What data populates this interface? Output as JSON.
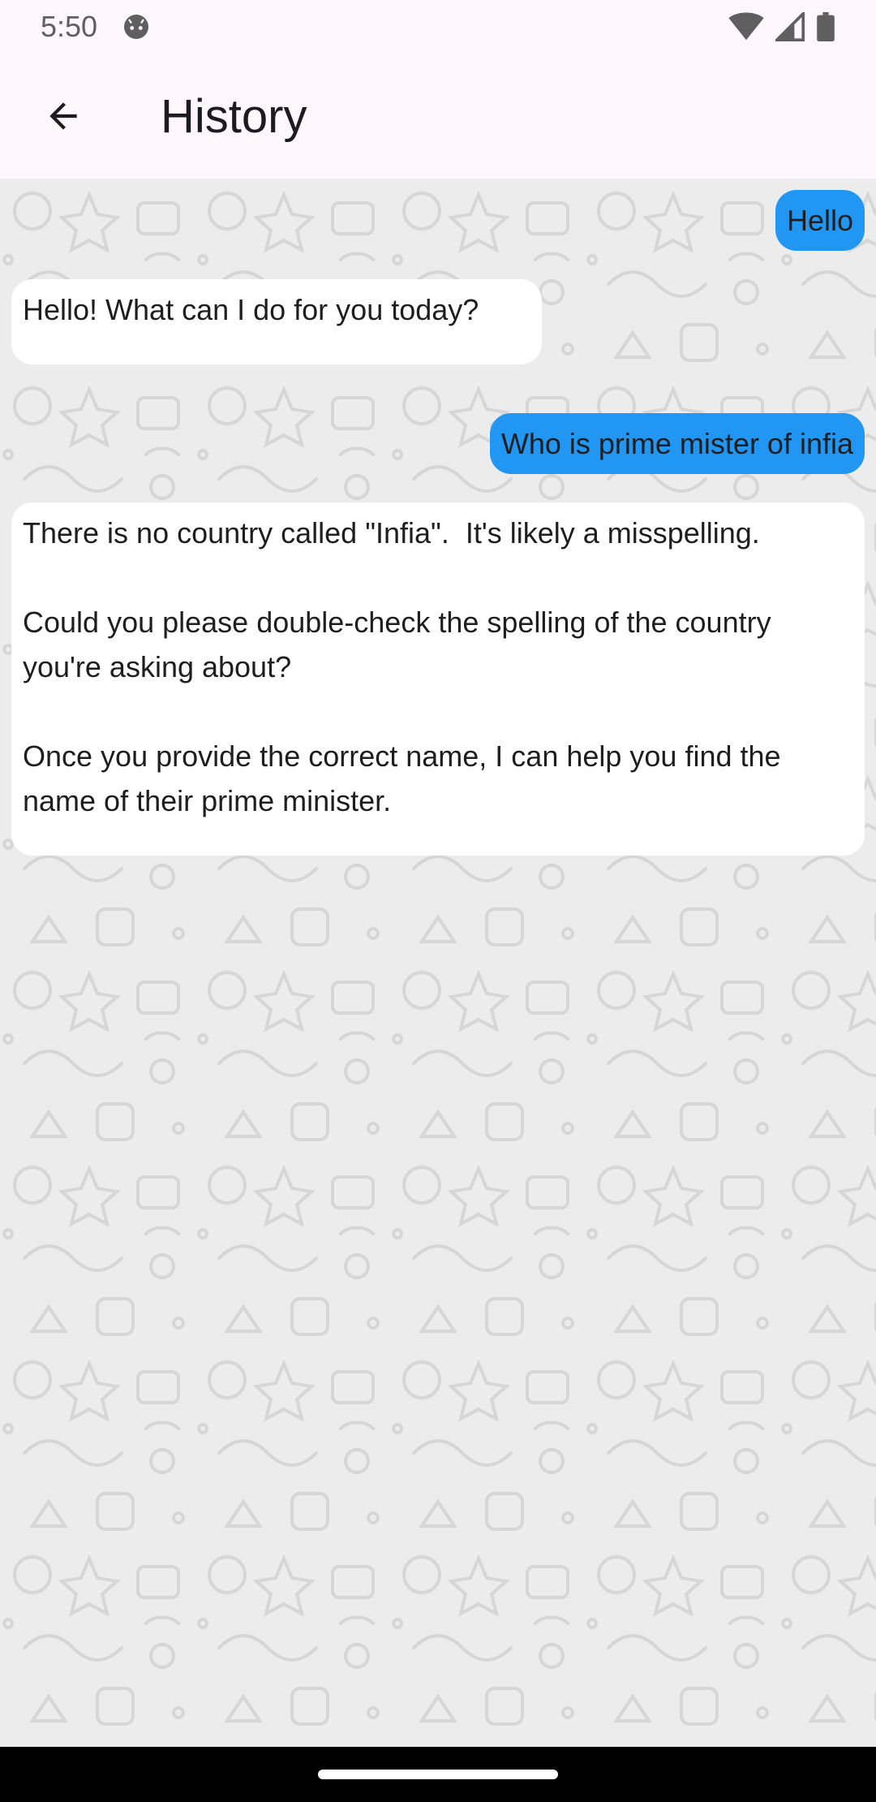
{
  "status_bar": {
    "time": "5:50",
    "app_icon": "android-face-icon",
    "icons": [
      "wifi-icon",
      "signal-icon",
      "battery-icon"
    ]
  },
  "app_bar": {
    "back_icon": "arrow-back-icon",
    "title": "History"
  },
  "colors": {
    "app_bar_bg": "#fdf7fc",
    "user_bubble": "#2196f3",
    "bot_bubble": "#ffffff",
    "chat_bg": "#ececec"
  },
  "messages": [
    {
      "sender": "user",
      "text": "Hello"
    },
    {
      "sender": "bot",
      "text": "Hello! What can I do for you today?"
    },
    {
      "sender": "user",
      "text": "Who is prime mister of infia"
    },
    {
      "sender": "bot",
      "text": "There is no country called \"Infia\".  It's likely a misspelling.\n\nCould you please double-check the spelling of the country you're asking about?\n\nOnce you provide the correct name, I can help you find the name of their prime minister."
    }
  ]
}
